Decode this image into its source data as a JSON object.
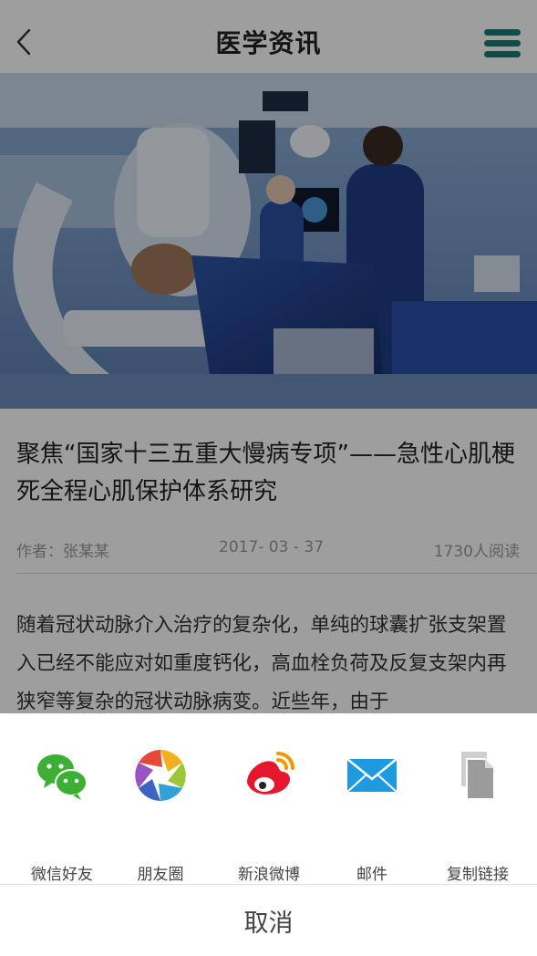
{
  "header": {
    "title": "医学资讯",
    "back_icon": "chevron-left-icon",
    "menu_icon": "hamburger-menu-icon",
    "menu_color": "#1f7a76"
  },
  "article": {
    "headline": "聚焦“国家十三五重大慢病专项”——急性心肌梗死全程心肌保护体系研究",
    "author": "作者：张某某",
    "date": "2017- 03 - 37",
    "reads": "1730人阅读",
    "body": "随着冠状动脉介入治疗的复杂化，单纯的球囊扩张支架置入已经不能应对如重度钙化，高血栓负荷及反复支架内再狭窄等复杂的冠状动脉病变。近些年，由于"
  },
  "share": {
    "items": [
      {
        "label": "微信好友",
        "icon": "wechat-icon"
      },
      {
        "label": "朋友圈",
        "icon": "moments-icon"
      },
      {
        "label": "新浪微博",
        "icon": "weibo-icon"
      },
      {
        "label": "邮件",
        "icon": "mail-icon"
      },
      {
        "label": "复制链接",
        "icon": "copy-link-icon"
      }
    ],
    "cancel_label": "取消"
  }
}
